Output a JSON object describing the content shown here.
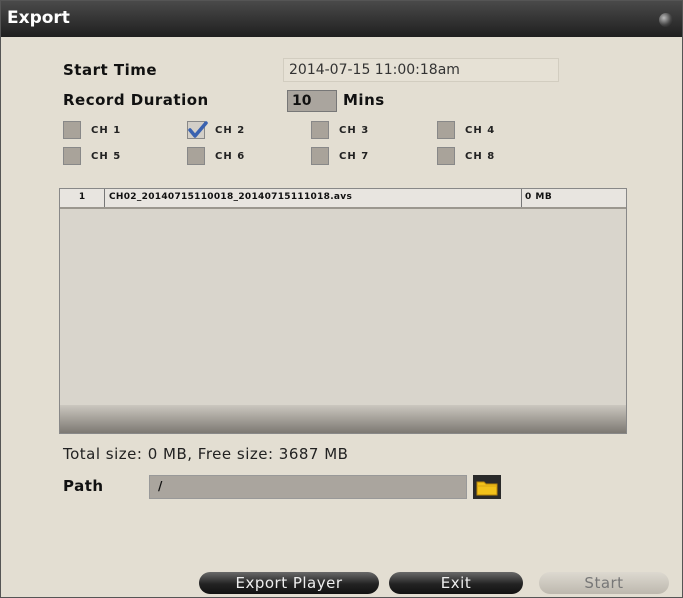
{
  "window": {
    "title": "Export"
  },
  "form": {
    "start_time_label": "Start Time",
    "start_time_value": "2014-07-15  11:00:18am",
    "duration_label": "Record Duration",
    "duration_value": "10",
    "duration_unit": "Mins"
  },
  "channels": [
    {
      "label": "CH 1",
      "checked": false
    },
    {
      "label": "CH 2",
      "checked": true
    },
    {
      "label": "CH 3",
      "checked": false
    },
    {
      "label": "CH 4",
      "checked": false
    },
    {
      "label": "CH 5",
      "checked": false
    },
    {
      "label": "CH 6",
      "checked": false
    },
    {
      "label": "CH 7",
      "checked": false
    },
    {
      "label": "CH 8",
      "checked": false
    }
  ],
  "file_list": {
    "rows": [
      {
        "index": "1",
        "name": "CH02_20140715110018_20140715111018.avs",
        "size": "0 MB"
      }
    ]
  },
  "summary": {
    "text": "Total size: 0 MB, Free size: 3687 MB"
  },
  "path": {
    "label": "Path",
    "value": "/"
  },
  "buttons": {
    "export_player": "Export Player",
    "exit": "Exit",
    "start": "Start"
  },
  "icons": {
    "close": "close-ball-icon",
    "folder": "folder-icon",
    "check": "checkmark-icon"
  },
  "colors": {
    "check_accent": "#3a62b0",
    "folder_yellow": "#f2c21b"
  }
}
